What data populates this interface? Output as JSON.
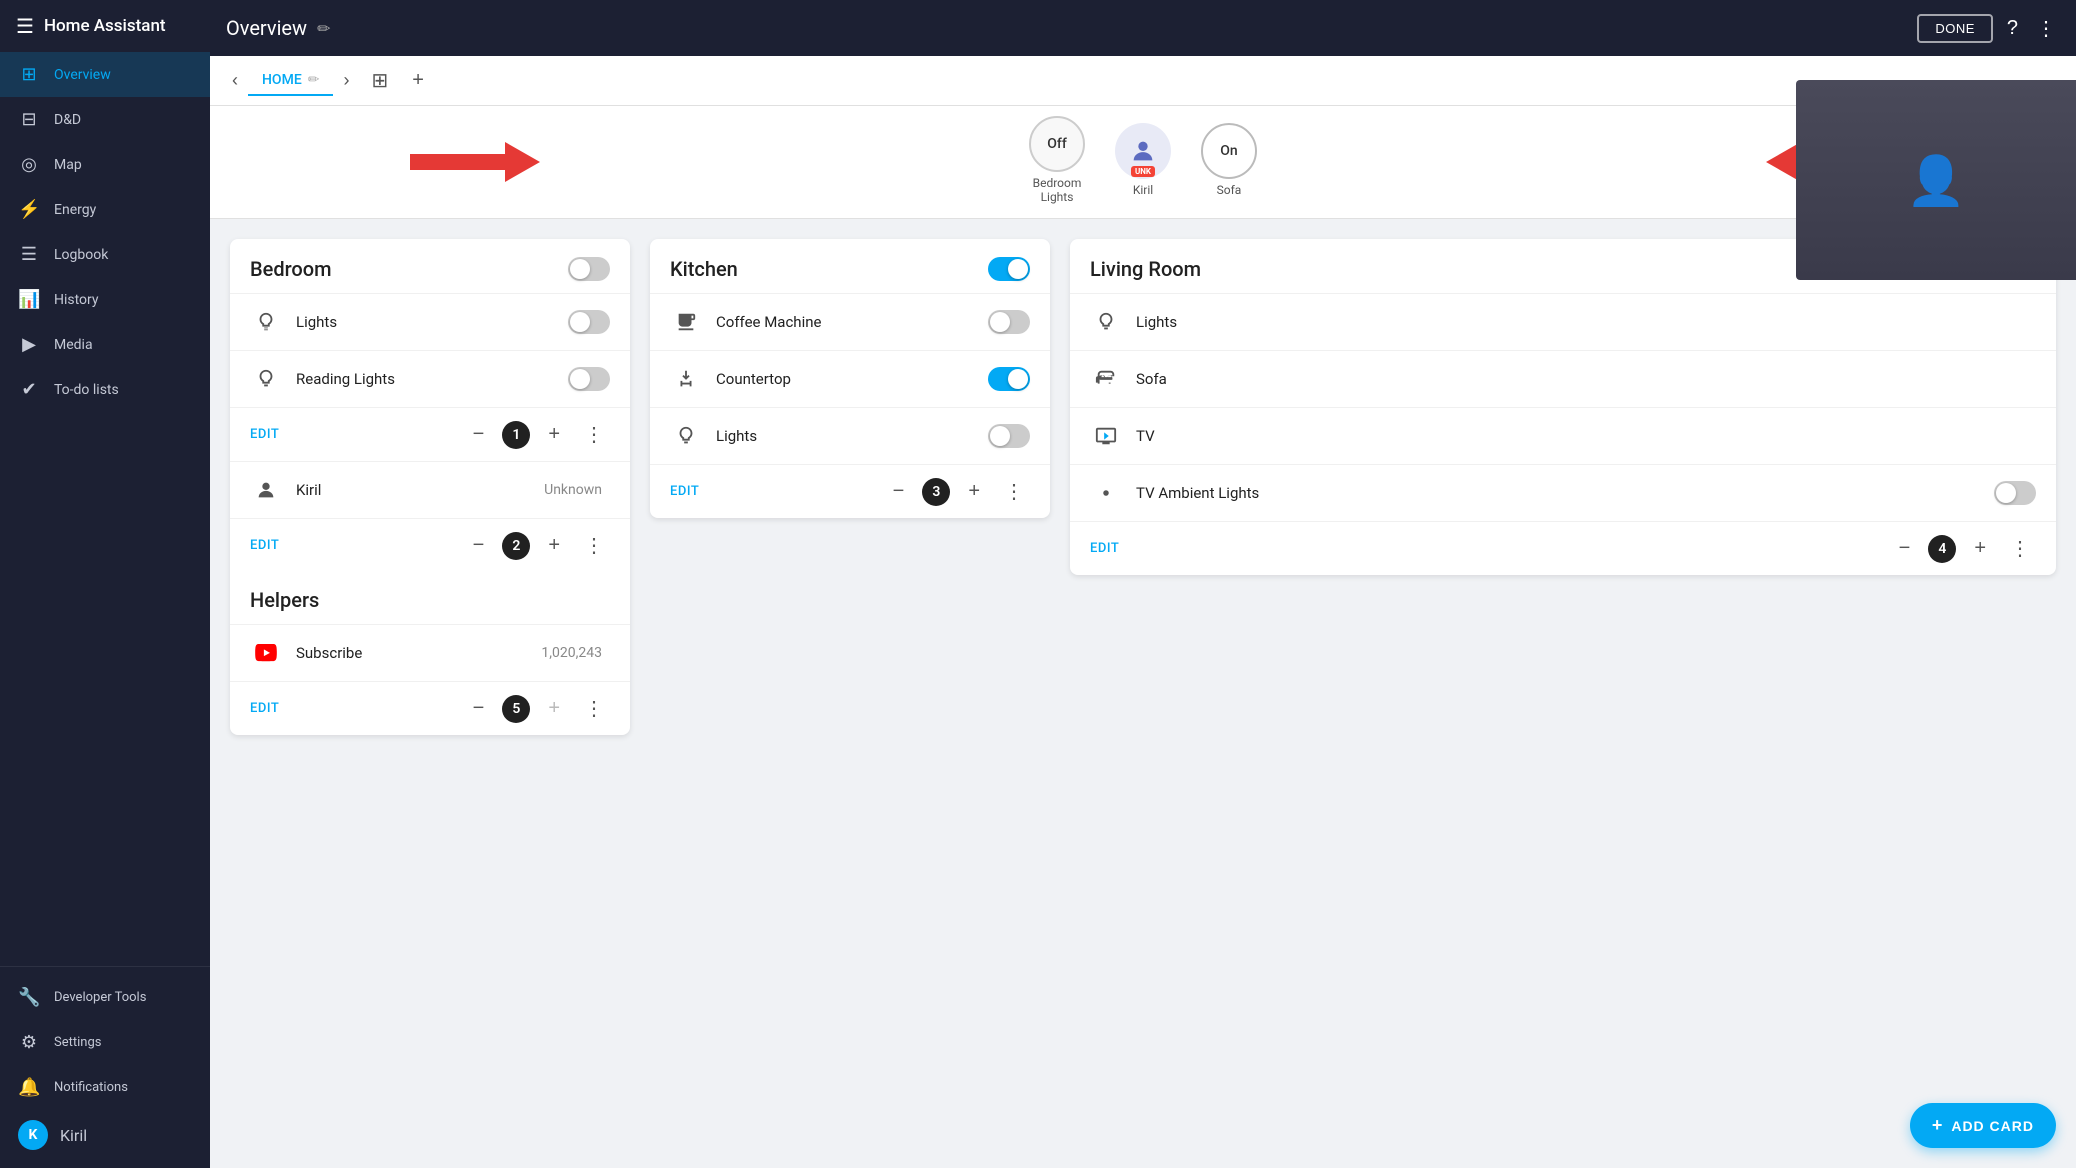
{
  "app": {
    "name": "Home Assistant"
  },
  "sidebar": {
    "items": [
      {
        "id": "overview",
        "label": "Overview",
        "icon": "⊞",
        "active": true
      },
      {
        "id": "dnd",
        "label": "D&D",
        "icon": "⊟"
      },
      {
        "id": "map",
        "label": "Map",
        "icon": "◎"
      },
      {
        "id": "energy",
        "label": "Energy",
        "icon": "⚡"
      },
      {
        "id": "logbook",
        "label": "Logbook",
        "icon": "☰"
      },
      {
        "id": "history",
        "label": "History",
        "icon": "📊"
      },
      {
        "id": "media",
        "label": "Media",
        "icon": "▶"
      },
      {
        "id": "todo",
        "label": "To-do lists",
        "icon": "✔"
      }
    ],
    "footer": [
      {
        "id": "devtools",
        "label": "Developer Tools",
        "icon": "🔧"
      },
      {
        "id": "settings",
        "label": "Settings",
        "icon": "⚙"
      },
      {
        "id": "notifications",
        "label": "Notifications",
        "icon": "🔔"
      }
    ],
    "user": {
      "name": "Kiril",
      "initial": "K"
    }
  },
  "topbar": {
    "title": "Overview",
    "done_label": "DONE"
  },
  "tabbar": {
    "tab_name": "HOME"
  },
  "entity_bar": {
    "bedroom_lights_label": "Bedroom\nLights",
    "bedroom_lights_state": "Off",
    "kiril_label": "Kiril",
    "kiril_state": "UNK",
    "sofa_label": "Sofa",
    "sofa_state": "On"
  },
  "bedroom_card": {
    "title": "Bedroom",
    "toggle_state": "off",
    "entities": [
      {
        "name": "Lights",
        "icon": "lights",
        "toggle": "off"
      },
      {
        "name": "Reading Lights",
        "icon": "lights",
        "toggle": "off"
      }
    ],
    "footer": {
      "edit": "EDIT",
      "badge": "1"
    },
    "footer2": {
      "edit": "EDIT",
      "badge": "2"
    }
  },
  "kiril_card": {
    "name": "Kiril",
    "value": "Unknown"
  },
  "helpers_card": {
    "title": "Helpers",
    "entities": [
      {
        "name": "Subscribe",
        "icon": "youtube",
        "value": "1,020,243"
      }
    ],
    "footer": {
      "edit": "EDIT",
      "badge": "5"
    }
  },
  "kitchen_card": {
    "title": "Kitchen",
    "toggle_state": "on",
    "entities": [
      {
        "name": "Coffee Machine",
        "icon": "coffee",
        "toggle": "unknown"
      },
      {
        "name": "Countertop",
        "icon": "plug",
        "toggle": "on"
      },
      {
        "name": "Lights",
        "icon": "lights",
        "toggle": "unknown"
      }
    ],
    "footer": {
      "edit": "EDIT",
      "badge": "3"
    }
  },
  "living_room_card": {
    "title": "Living Room",
    "entities": [
      {
        "name": "Lights",
        "icon": "lights"
      },
      {
        "name": "Sofa",
        "icon": "sofa"
      },
      {
        "name": "TV",
        "icon": "tv"
      },
      {
        "name": "TV Ambient Lights",
        "icon": "ambient",
        "toggle": "off"
      }
    ],
    "footer": {
      "edit": "EDIT",
      "badge": "4"
    }
  },
  "add_card": {
    "label": "ADD CARD"
  }
}
